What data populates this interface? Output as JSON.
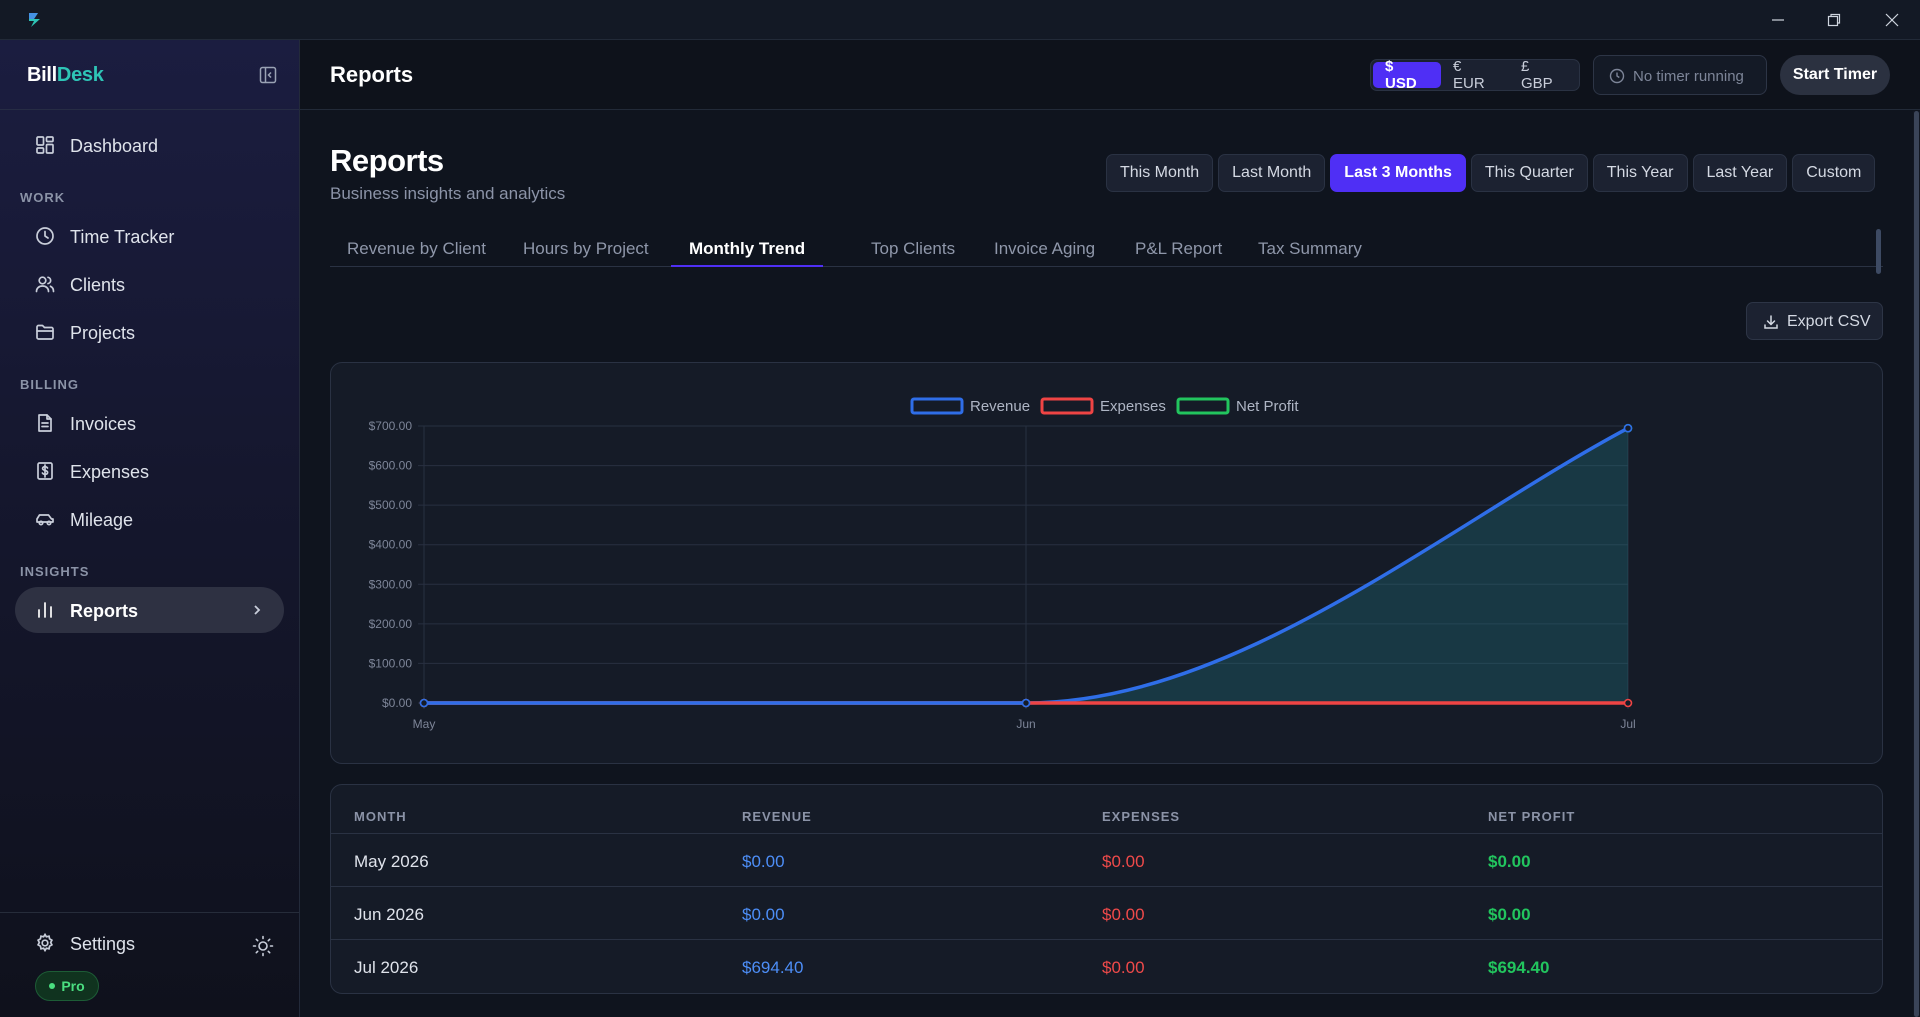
{
  "app": {
    "brand_part1": "Bill",
    "brand_part2": "Desk"
  },
  "sidebar": {
    "items": {
      "dashboard": "Dashboard",
      "time_tracker": "Time Tracker",
      "clients": "Clients",
      "projects": "Projects",
      "invoices": "Invoices",
      "expenses": "Expenses",
      "mileage": "Mileage",
      "reports": "Reports"
    },
    "sections": {
      "work": "WORK",
      "billing": "BILLING",
      "insights": "INSIGHTS"
    },
    "settings": "Settings",
    "plan_badge": "Pro"
  },
  "header": {
    "title": "Reports",
    "currencies": [
      "$ USD",
      "€ EUR",
      "£ GBP"
    ],
    "active_currency": "$ USD",
    "timer_status": "No timer running",
    "start_timer": "Start Timer"
  },
  "page": {
    "title": "Reports",
    "subtitle": "Business insights and analytics",
    "ranges": [
      "This Month",
      "Last Month",
      "Last 3 Months",
      "This Quarter",
      "This Year",
      "Last Year",
      "Custom"
    ],
    "active_range": "Last 3 Months",
    "tabs": [
      "Revenue by Client",
      "Hours by Project",
      "Monthly Trend",
      "Top Clients",
      "Invoice Aging",
      "P&L Report",
      "Tax Summary"
    ],
    "active_tab": "Monthly Trend",
    "export_label": "Export CSV"
  },
  "colors": {
    "accent": "#4f2ff5",
    "revenue": "#2f6ee8",
    "expenses": "#ef4444",
    "net_profit": "#22c55e",
    "brand_teal": "#2ec4b6"
  },
  "chart_data": {
    "type": "line",
    "categories": [
      "May",
      "Jun",
      "Jul"
    ],
    "series": [
      {
        "name": "Revenue",
        "values": [
          0,
          0,
          694.4
        ],
        "color": "#2f6ee8",
        "filled": true
      },
      {
        "name": "Expenses",
        "values": [
          0,
          0,
          0
        ],
        "color": "#ef4444"
      },
      {
        "name": "Net Profit",
        "values": [
          0,
          0,
          694.4
        ],
        "color": "#22c55e"
      }
    ],
    "ylim": [
      0,
      700
    ],
    "yticks": [
      "$0.00",
      "$100.00",
      "$200.00",
      "$300.00",
      "$400.00",
      "$500.00",
      "$600.00",
      "$700.00"
    ],
    "legend_position": "top-center",
    "grid": true
  },
  "table": {
    "headers": [
      "MONTH",
      "REVENUE",
      "EXPENSES",
      "NET PROFIT"
    ],
    "rows": [
      [
        "May 2026",
        "$0.00",
        "$0.00",
        "$0.00"
      ],
      [
        "Jun 2026",
        "$0.00",
        "$0.00",
        "$0.00"
      ],
      [
        "Jul 2026",
        "$694.40",
        "$0.00",
        "$694.40"
      ]
    ]
  }
}
